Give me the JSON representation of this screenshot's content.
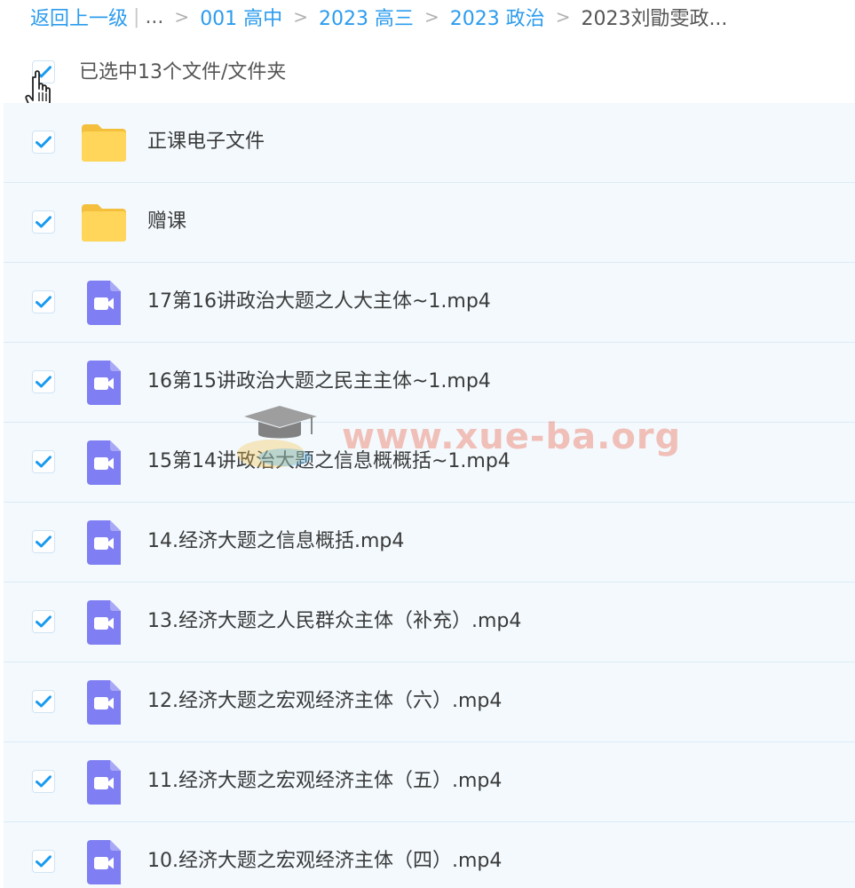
{
  "breadcrumb": {
    "back_label": "返回上一级",
    "pipe": "|",
    "ellipsis": "...",
    "separator": ">",
    "items": [
      "001 高中",
      "2023 高三",
      "2023 政治"
    ],
    "current": "2023刘勖雯政..."
  },
  "selection": {
    "count_text": "已选中13个文件/文件夹",
    "all_checked": true
  },
  "files": [
    {
      "name": "正课电子文件",
      "type": "folder",
      "checked": true
    },
    {
      "name": "赠课",
      "type": "folder",
      "checked": true
    },
    {
      "name": "17第16讲政治大题之人大主体~1.mp4",
      "type": "video",
      "checked": true
    },
    {
      "name": "16第15讲政治大题之民主主体~1.mp4",
      "type": "video",
      "checked": true
    },
    {
      "name": "15第14讲政治大题之信息概概括~1.mp4",
      "type": "video",
      "checked": true
    },
    {
      "name": "14.经济大题之信息概括.mp4",
      "type": "video",
      "checked": true
    },
    {
      "name": "13.经济大题之人民群众主体（补充）.mp4",
      "type": "video",
      "checked": true
    },
    {
      "name": "12.经济大题之宏观经济主体（六）.mp4",
      "type": "video",
      "checked": true
    },
    {
      "name": "11.经济大题之宏观经济主体（五）.mp4",
      "type": "video",
      "checked": true
    },
    {
      "name": "10.经济大题之宏观经济主体（四）.mp4",
      "type": "video",
      "checked": true
    }
  ],
  "watermark": {
    "text": "www.xue-ba.org"
  },
  "colors": {
    "link": "#2c9cee",
    "check": "#1a9bf0",
    "folder": "#ffd659",
    "video": "#7f7ef2",
    "row_bg": "#f3f9fd"
  }
}
